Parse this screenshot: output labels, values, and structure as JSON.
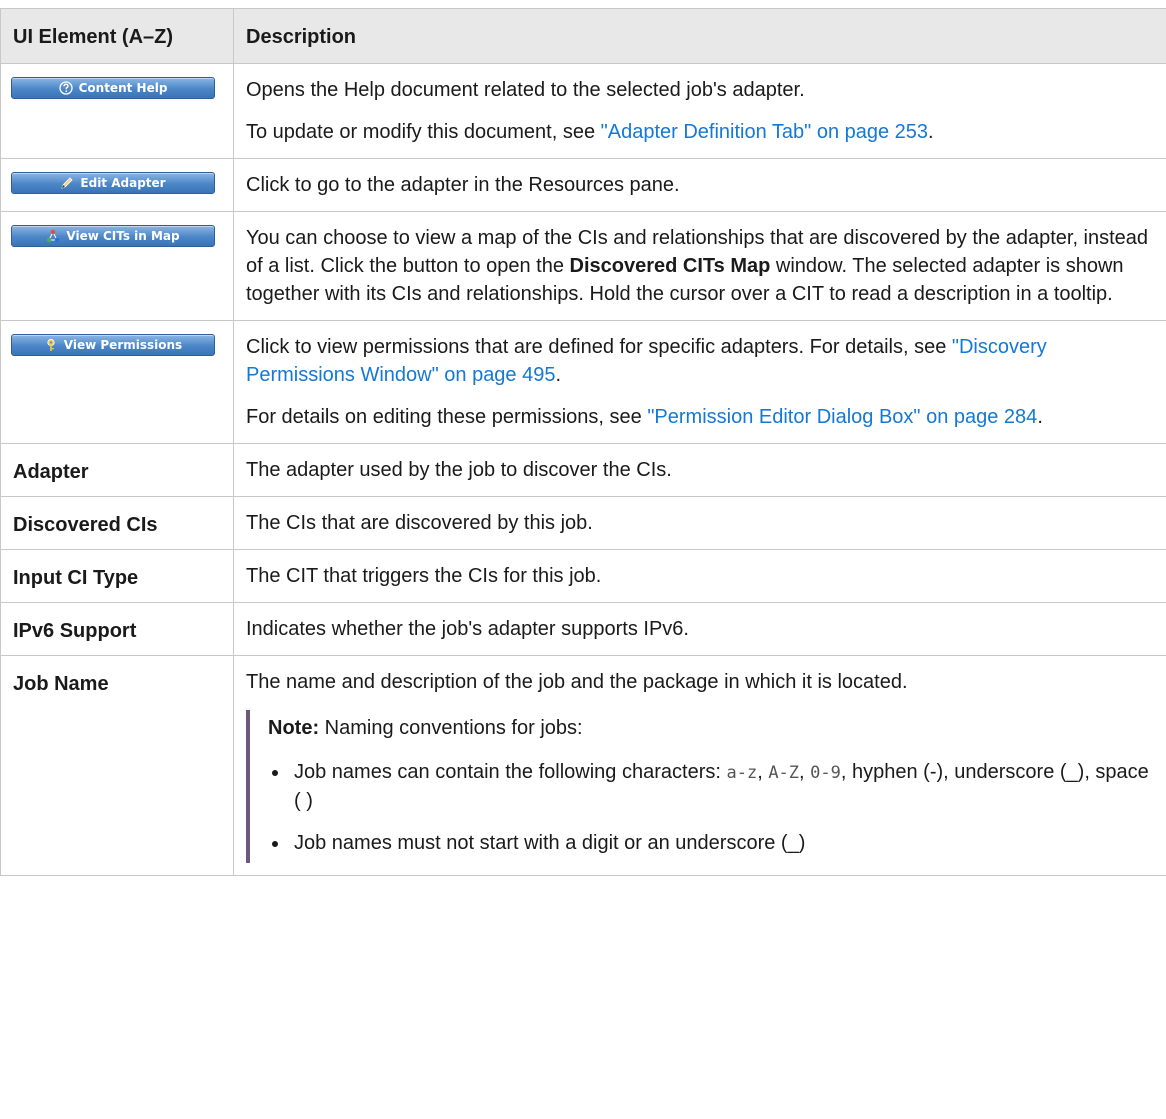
{
  "table": {
    "headers": {
      "element": "UI Element (A–Z)",
      "description": "Description"
    },
    "rows": {
      "content_help": {
        "button_label": "Content Help",
        "icon": "help-question-icon",
        "desc1": "Opens the Help document related to the selected job's adapter.",
        "desc2_pre": "To update or modify this document, see ",
        "desc2_link": "\"Adapter Definition Tab\" on page 253",
        "desc2_post": "."
      },
      "edit_adapter": {
        "button_label": "Edit Adapter",
        "icon": "pencil-icon",
        "desc": "Click to go to the adapter in the Resources pane."
      },
      "view_cits": {
        "button_label": "View CITs in Map",
        "icon": "map-nodes-icon",
        "desc_pre": "You can choose to view a map of the CIs and relationships that are discovered by the adapter, instead of a list. Click the button to open the ",
        "desc_bold": "Discovered CITs Map",
        "desc_post": " window. The selected adapter is shown together with its CIs and relationships. Hold the cursor over a CIT to read a description in a tooltip."
      },
      "view_permissions": {
        "button_label": "View Permissions",
        "icon": "key-icon",
        "desc1_pre": "Click to view permissions that are defined for specific adapters. For details, see ",
        "desc1_link": "\"Discovery Permissions Window\" on page 495",
        "desc1_post": ".",
        "desc2_pre": "For details on editing these permissions, see ",
        "desc2_link": "\"Permission Editor Dialog Box\" on page 284",
        "desc2_post": "."
      },
      "adapter": {
        "element": "Adapter",
        "desc": "The adapter used by the job to discover the CIs."
      },
      "discovered_cis": {
        "element": "Discovered CIs",
        "desc": "The CIs that are discovered by this job."
      },
      "input_ci_type": {
        "element": "Input CI Type",
        "desc": "The CIT that triggers the CIs for this job."
      },
      "ipv6": {
        "element": "IPv6 Support",
        "desc": "Indicates whether the job's adapter supports IPv6."
      },
      "job_name": {
        "element": "Job Name",
        "desc": "The name and description of the job and the package in which it is located.",
        "note_label": "Note:",
        "note_text": " Naming conventions for jobs:",
        "bullet1_pre": "Job names can contain the following characters: ",
        "bullet1_code1": "a-z",
        "bullet1_sep1": ", ",
        "bullet1_code2": "A-Z",
        "bullet1_sep2": ", ",
        "bullet1_code3": "0-9",
        "bullet1_post": ", hyphen (-), underscore (_), space ( )",
        "bullet2": "Job names must not start with a digit or an underscore (_)"
      }
    }
  },
  "colors": {
    "link": "#1478d6",
    "header_bg": "#e8e8e8",
    "button": "#4b86c7",
    "note_bar": "#6c5a7a"
  }
}
